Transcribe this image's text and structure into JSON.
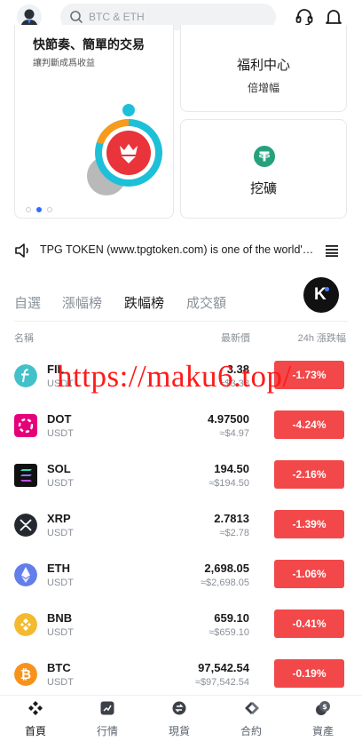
{
  "search": {
    "placeholder": "BTC & ETH"
  },
  "banner": {
    "main": {
      "title": "快節奏、簡單的交易",
      "subtitle": "讓判斷成爲收益"
    },
    "welfare": {
      "title": "福利中心",
      "subtitle": "倍增幅"
    },
    "mine": {
      "title": "挖礦"
    }
  },
  "announcement": {
    "text": "TPG TOKEN (www.tpgtoken.com) is one of the world's leading"
  },
  "tabs": [
    {
      "label": "自選",
      "active": false
    },
    {
      "label": "漲幅榜",
      "active": false
    },
    {
      "label": "跌幅榜",
      "active": true
    },
    {
      "label": "成交額",
      "active": false
    }
  ],
  "columns": {
    "name": "名稱",
    "price": "最新價",
    "change": "24h 漲跌幅"
  },
  "coins": [
    {
      "symbol": "FIL",
      "quote": "USDT",
      "price": "3.38",
      "fiat": "≈$3.38",
      "change": "-1.73%",
      "icon": "filecoin-icon",
      "color": "#42c1ca"
    },
    {
      "symbol": "DOT",
      "quote": "USDT",
      "price": "4.97500",
      "fiat": "≈$4.97",
      "change": "-4.24%",
      "icon": "polkadot-icon",
      "color": "#e6007a"
    },
    {
      "symbol": "SOL",
      "quote": "USDT",
      "price": "194.50",
      "fiat": "≈$194.50",
      "change": "-2.16%",
      "icon": "solana-icon",
      "color": "#111111"
    },
    {
      "symbol": "XRP",
      "quote": "USDT",
      "price": "2.7813",
      "fiat": "≈$2.78",
      "change": "-1.39%",
      "icon": "xrp-icon",
      "color": "#23292f"
    },
    {
      "symbol": "ETH",
      "quote": "USDT",
      "price": "2,698.05",
      "fiat": "≈$2,698.05",
      "change": "-1.06%",
      "icon": "ethereum-icon",
      "color": "#627eea"
    },
    {
      "symbol": "BNB",
      "quote": "USDT",
      "price": "659.10",
      "fiat": "≈$659.10",
      "change": "-0.41%",
      "icon": "bnb-icon",
      "color": "#f3ba2f"
    },
    {
      "symbol": "BTC",
      "quote": "USDT",
      "price": "97,542.54",
      "fiat": "≈$97,542.54",
      "change": "-0.19%",
      "icon": "bitcoin-icon",
      "color": "#f7931a"
    }
  ],
  "watermark": "https://maku6.top/",
  "bottom_nav": [
    {
      "label": "首頁",
      "icon": "home-icon",
      "active": true
    },
    {
      "label": "行情",
      "icon": "market-icon",
      "active": false
    },
    {
      "label": "現貨",
      "icon": "spot-icon",
      "active": false
    },
    {
      "label": "合約",
      "icon": "contract-icon",
      "active": false
    },
    {
      "label": "資產",
      "icon": "assets-icon",
      "active": false
    }
  ],
  "colors": {
    "negative": "#f2484a",
    "accent": "#2f6bff",
    "muted": "#8a9099"
  }
}
